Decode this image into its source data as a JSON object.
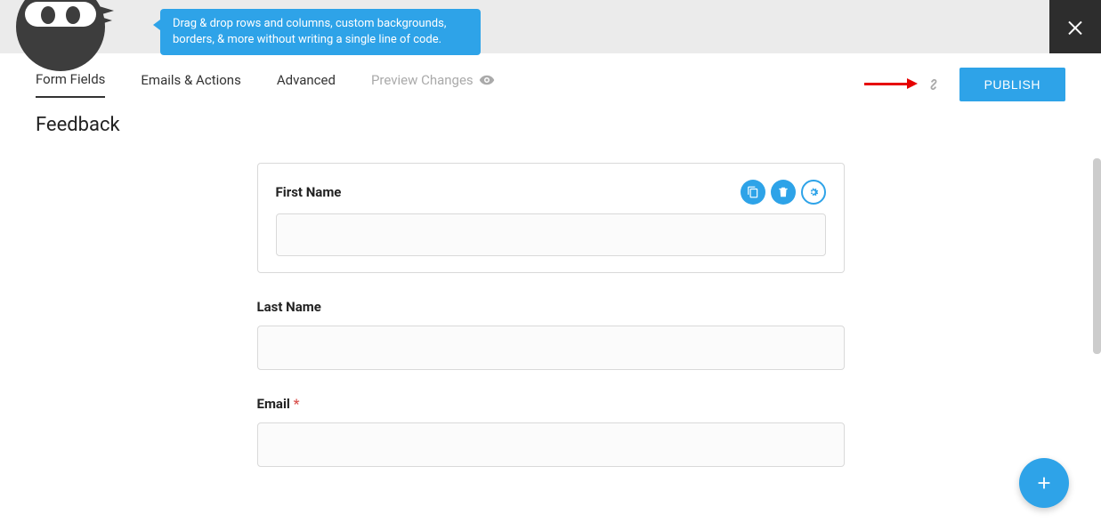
{
  "tooltip_text": "Drag & drop rows and columns, custom backgrounds, borders, & more without writing a single line of code.",
  "nav": {
    "tabs": [
      {
        "label": "Form Fields",
        "active": true
      },
      {
        "label": "Emails & Actions",
        "active": false
      },
      {
        "label": "Advanced",
        "active": false
      },
      {
        "label": "Preview Changes",
        "muted": true
      }
    ]
  },
  "publish_label": "PUBLISH",
  "form_title": "Feedback",
  "fields": [
    {
      "label": "First Name",
      "required": false,
      "active": true,
      "value": ""
    },
    {
      "label": "Last Name",
      "required": false,
      "active": false,
      "value": ""
    },
    {
      "label": "Email",
      "required": true,
      "active": false,
      "value": ""
    }
  ],
  "required_marker": "*",
  "colors": {
    "primary": "#2ea3e8",
    "annotation": "#e60000"
  }
}
